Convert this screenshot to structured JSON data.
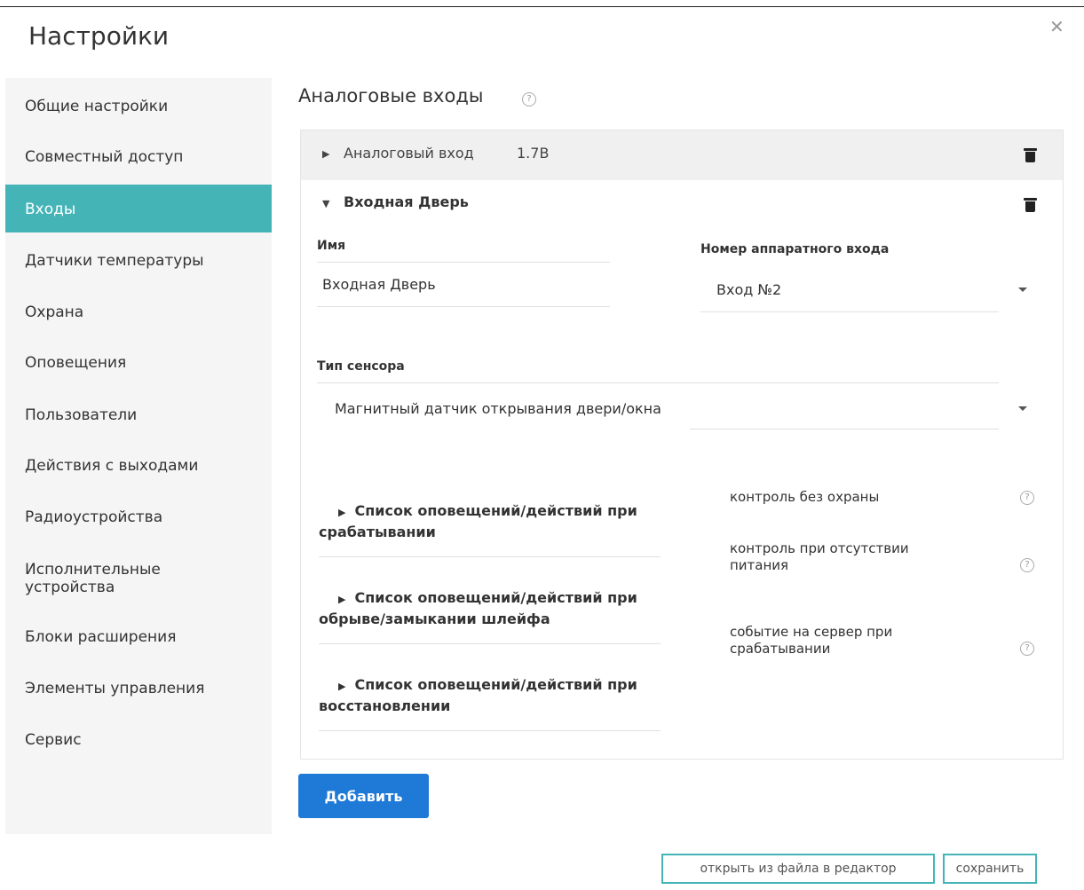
{
  "dialog": {
    "title": "Настройки",
    "close_icon": "close-icon"
  },
  "sidebar": {
    "items": [
      {
        "label": "Общие настройки"
      },
      {
        "label": "Совместный доступ"
      },
      {
        "label": "Входы",
        "active": true
      },
      {
        "label": "Датчики температуры"
      },
      {
        "label": "Охрана"
      },
      {
        "label": "Оповещения"
      },
      {
        "label": "Пользователи"
      },
      {
        "label": "Действия с выходами"
      },
      {
        "label": "Радиоустройства"
      },
      {
        "label": "Исполнительные устройства"
      },
      {
        "label": "Блоки расширения"
      },
      {
        "label": "Элементы управления"
      },
      {
        "label": "Сервис"
      }
    ]
  },
  "section": {
    "title": "Аналоговые входы",
    "help": "?"
  },
  "inputs": [
    {
      "name": "Аналоговый вход",
      "value": "1.7В",
      "expanded": false
    },
    {
      "name": "Входная Дверь",
      "expanded": true
    }
  ],
  "form": {
    "name_label": "Имя",
    "name_value": "Входная Дверь",
    "hw_label": "Номер аппаратного входа",
    "hw_value": "Вход №2",
    "sensor_label": "Тип сенсора",
    "sensor_value": "Магнитный датчик открывания двери/окна",
    "accordions": [
      {
        "label": "Список оповещений/действий при срабатывании"
      },
      {
        "label": "Список оповещений/действий при обрыве/замыкании шлейфа"
      },
      {
        "label": "Список оповещений/действий при восстановлении"
      }
    ],
    "options": [
      {
        "label": "контроль без охраны"
      },
      {
        "label": "контроль при отсутствии питания"
      },
      {
        "label": "событие на сервер при срабатывании"
      }
    ]
  },
  "buttons": {
    "add": "Добавить",
    "open_file": "открыть из файла в редактор",
    "save": "сохранить"
  },
  "colors": {
    "accent": "#45b4b7",
    "primary": "#1f79d6",
    "sidebar_bg": "#f5f5f5"
  }
}
